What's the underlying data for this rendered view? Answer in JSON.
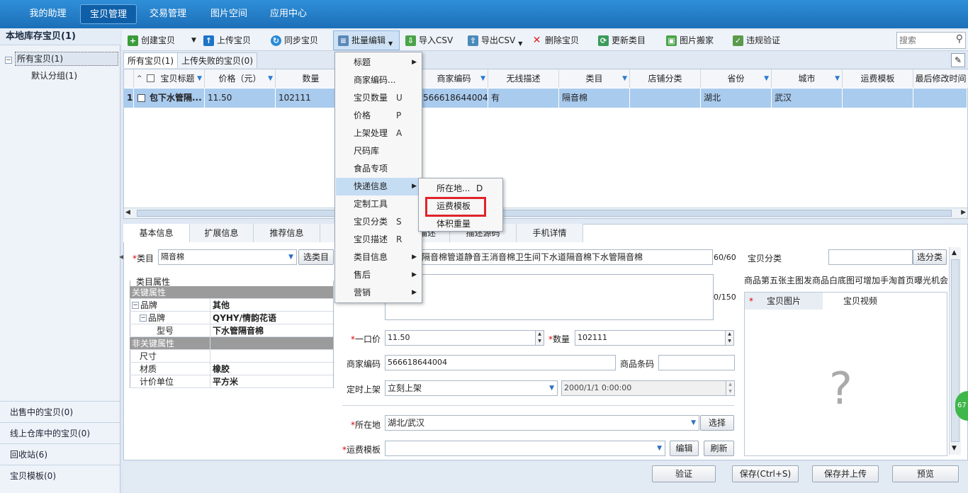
{
  "nav": {
    "tabs": [
      "我的助理",
      "宝贝管理",
      "交易管理",
      "图片空间",
      "应用中心"
    ]
  },
  "left": {
    "title": "本地库存宝贝(1)",
    "tree_root": "所有宝贝(1)",
    "tree_child": "默认分组(1)",
    "bottom_items": [
      "出售中的宝贝(0)",
      "线上仓库中的宝贝(0)",
      "回收站(6)",
      "宝贝模板(0)"
    ]
  },
  "toolbar": {
    "create": "创建宝贝",
    "upload": "上传宝贝",
    "sync": "同步宝贝",
    "batch": "批量编辑",
    "import": "导入CSV",
    "export": "导出CSV",
    "delete": "删除宝贝",
    "update_cat": "更新类目",
    "image_move": "图片搬家",
    "violation": "违规验证",
    "search_placeholder": "搜索"
  },
  "list_tabs": [
    "所有宝贝(1)",
    "上传失败的宝贝(0)"
  ],
  "grid": {
    "headers": [
      "宝贝标题",
      "价格（元）",
      "数量",
      "商家编码",
      "无线描述",
      "类目",
      "店铺分类",
      "省份",
      "城市",
      "运费模板",
      "最后修改时间"
    ],
    "row": {
      "index": "1",
      "title": "包下水管隔...",
      "price": "11.50",
      "qty": "102111",
      "code": "566618644004",
      "mobile": "有",
      "category": "隔音棉",
      "shop_cat": "",
      "province": "湖北",
      "city": "武汉",
      "freight": "",
      "modified": ""
    }
  },
  "batch_menu": {
    "items": [
      {
        "label": "标题",
        "key": "",
        "sub": true
      },
      {
        "label": "商家编码...",
        "key": "",
        "sub": false
      },
      {
        "label": "宝贝数量",
        "key": "U",
        "sub": false
      },
      {
        "label": "价格",
        "key": "P",
        "sub": false
      },
      {
        "label": "上架处理",
        "key": "A",
        "sub": false
      },
      {
        "label": "尺码库",
        "key": "",
        "sub": false
      },
      {
        "label": "食品专项",
        "key": "",
        "sub": false
      },
      {
        "label": "快递信息",
        "key": "",
        "sub": true
      },
      {
        "label": "定制工具",
        "key": "",
        "sub": false
      },
      {
        "label": "宝贝分类",
        "key": "S",
        "sub": false
      },
      {
        "label": "宝贝描述",
        "key": "R",
        "sub": false
      },
      {
        "label": "类目信息",
        "key": "",
        "sub": true
      },
      {
        "label": "售后",
        "key": "",
        "sub": true
      },
      {
        "label": "营销",
        "key": "",
        "sub": true
      }
    ]
  },
  "express_menu": {
    "items": [
      {
        "label": "所在地...",
        "key": "D"
      },
      {
        "label": "运费模板",
        "key": ""
      },
      {
        "label": "体积重量",
        "key": ""
      }
    ]
  },
  "detail_tabs": [
    "基本信息",
    "扩展信息",
    "推荐信息",
    "描述",
    "描述源码",
    "手机详情"
  ],
  "form": {
    "category_label": "类目",
    "category_value": "隔音棉",
    "select_category": "选类目",
    "attr_title": "类目属性",
    "key_attrs": "关键属性",
    "nonkey_attrs": "非关键属性",
    "attrs": [
      {
        "name": "品牌",
        "value": "其他"
      },
      {
        "name": "品牌",
        "value": "QYHY/情韵花语"
      },
      {
        "name": "型号",
        "value": "下水管隔音棉"
      }
    ],
    "nonkey": [
      {
        "name": "尺寸",
        "value": ""
      },
      {
        "name": "材质",
        "value": "橡胶"
      },
      {
        "name": "计价单位",
        "value": "平方米"
      }
    ],
    "title_value": "隔音棉管道静音王消音棉卫生间下水道隔音棉下水管隔音棉",
    "title_count": "60/60",
    "sub_count": "0/150",
    "price_label": "一口价",
    "price_value": "11.50",
    "qty_label": "数量",
    "qty_value": "102111",
    "code_label": "商家编码",
    "code_value": "566618644004",
    "barcode_label": "商品条码",
    "list_label": "定时上架",
    "list_value": "立刻上架",
    "list_time": "2000/1/1 0:00:00",
    "location_label": "所在地",
    "location_value": "湖北/武汉",
    "select_btn": "选择",
    "freight_label": "运费模板",
    "edit_btn": "编辑",
    "refresh_btn": "刷新",
    "shop_cat_label": "宝贝分类",
    "shop_cat_btn": "选分类",
    "notice": "商品第五张主图发商品白底图可增加手淘首页曝光机会",
    "img_tab": "宝贝图片",
    "video_tab": "宝贝视频",
    "img_placeholder": "?"
  },
  "bottom": {
    "verify": "验证",
    "save": "保存(Ctrl+S)",
    "save_upload": "保存并上传",
    "preview": "预览",
    "badge": "67"
  }
}
